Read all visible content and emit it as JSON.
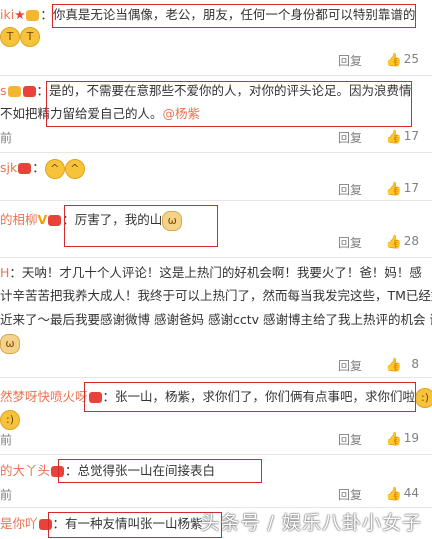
{
  "comments": [
    {
      "username": "iki",
      "lines": [
        "：你真是无论当偶像，老公，朋友，任何一个身份都可以特别靠谱的"
      ],
      "emoji_line": [
        "😭",
        "😭"
      ],
      "time_prefix": "",
      "reply_label": "回复",
      "likes": "25"
    },
    {
      "username": "s",
      "lines": [
        "：是的，不需要在意那些不爱你的人，对你的评头论足。因为浪费情",
        "不如把精力留给爱自己的人。"
      ],
      "mention": "@杨紫",
      "time_prefix": "前",
      "reply_label": "回复",
      "likes": "17"
    },
    {
      "username": "sjk",
      "lines": [
        "："
      ],
      "time_prefix": "",
      "reply_label": "回复",
      "likes": "17"
    },
    {
      "username": "的相柳",
      "vip_mark": "V",
      "lines": [
        "：厉害了，我的山"
      ],
      "time_prefix": "",
      "reply_label": "回复",
      "likes": "28"
    },
    {
      "username": "H",
      "lines": [
        "：天呐！才几十个人评论！这是上热门的好机会啊！我要火了！爸！妈！感",
        "计辛苦苦把我养大成人！我终于可以上热门了，然而每当我发完这些，TM已经好",
        "近来了～最后我要感谢微博 感谢爸妈 感谢cctv 感谢博主给了我上热评的机会 谢"
      ],
      "time_prefix": "",
      "reply_label": "回复",
      "likes": "8"
    },
    {
      "username": "然梦呀快喷火呀",
      "lines": [
        "：张一山，杨紫，求你们了，你们俩有点事吧，求你们啦"
      ],
      "time_prefix": "前",
      "reply_label": "回复",
      "likes": "19"
    },
    {
      "username": "的大丫头",
      "lines": [
        "：总觉得张一山在间接表白"
      ],
      "time_prefix": "前",
      "reply_label": "回复",
      "likes": "44"
    },
    {
      "username": "是你吖",
      "lines": [
        "：有一种友情叫张一山杨紫"
      ],
      "time_prefix": "",
      "reply_label": "",
      "likes": ""
    }
  ],
  "watermark": "头条号 / 娱乐八卦小女子",
  "colors": {
    "username": "#eb7350",
    "highlight_box": "#d62a2a",
    "meta": "#808080"
  }
}
